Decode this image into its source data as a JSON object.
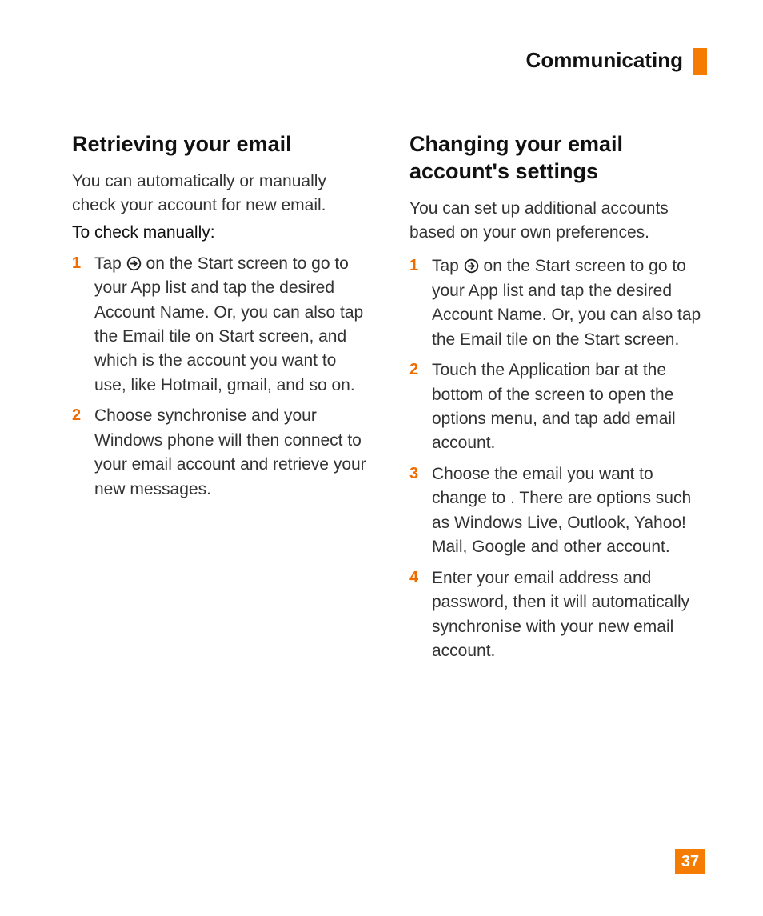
{
  "header": {
    "section_title": "Communicating",
    "page_number": "37"
  },
  "accent_color": "#f57c00",
  "left": {
    "heading": "Retrieving your email",
    "intro": "You can automatically or manually check your account for new email.",
    "subhead": "To check manually:",
    "steps": [
      {
        "num": "1",
        "before_icon": "Tap ",
        "after_icon": " on the Start screen to go to your App list and tap the desired Account Name. Or, you can also tap the Email tile on Start screen, and which is the account you want to use, like Hotmail, gmail, and so on."
      },
      {
        "num": "2",
        "text": "Choose synchronise and your Windows phone will then connect to your email account and retrieve your new messages."
      }
    ]
  },
  "right": {
    "heading": "Changing your email account's settings",
    "intro": "You can set up additional accounts based on your own preferences.",
    "steps": [
      {
        "num": "1",
        "before_icon": "Tap ",
        "after_icon": " on the Start screen to go to your App list and tap the desired Account Name. Or, you can also tap the Email tile on the Start screen."
      },
      {
        "num": "2",
        "text": "Touch the Application bar at the bottom of the screen to open the options menu, and tap add email account."
      },
      {
        "num": "3",
        "text": "Choose the email you want to change to . There are options such as Windows Live, Outlook, Yahoo! Mail, Google and other account."
      },
      {
        "num": "4",
        "text": "Enter your email address and password, then it will automatically synchronise with your new email account."
      }
    ]
  }
}
